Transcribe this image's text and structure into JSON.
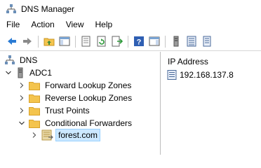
{
  "window": {
    "title": "DNS Manager"
  },
  "menu": {
    "items": [
      "File",
      "Action",
      "View",
      "Help"
    ]
  },
  "toolbar": {
    "buttons": [
      "back-icon",
      "forward-icon",
      "up-folder-icon",
      "show-hide-console-tree-icon",
      "properties-icon",
      "refresh-icon",
      "export-list-icon",
      "help-icon",
      "show-hide-action-pane-icon",
      "server-icon",
      "zone-icon",
      "record-icon"
    ]
  },
  "tree": {
    "root": "DNS",
    "server": "ADC1",
    "forward_zones": "Forward Lookup Zones",
    "reverse_zones": "Reverse Lookup Zones",
    "trust_points": "Trust Points",
    "conditional_forwarders": "Conditional Forwarders",
    "forwarder_domain": "forest.com"
  },
  "list": {
    "column_header": "IP Address",
    "rows": [
      {
        "ip": "192.168.137.8"
      }
    ]
  },
  "colors": {
    "folder": "#f4c44e",
    "folder_dark": "#d9a22a",
    "selection": "#cce8ff",
    "selection_border": "#99d1ff",
    "arrow_blue": "#2a7bd4"
  }
}
